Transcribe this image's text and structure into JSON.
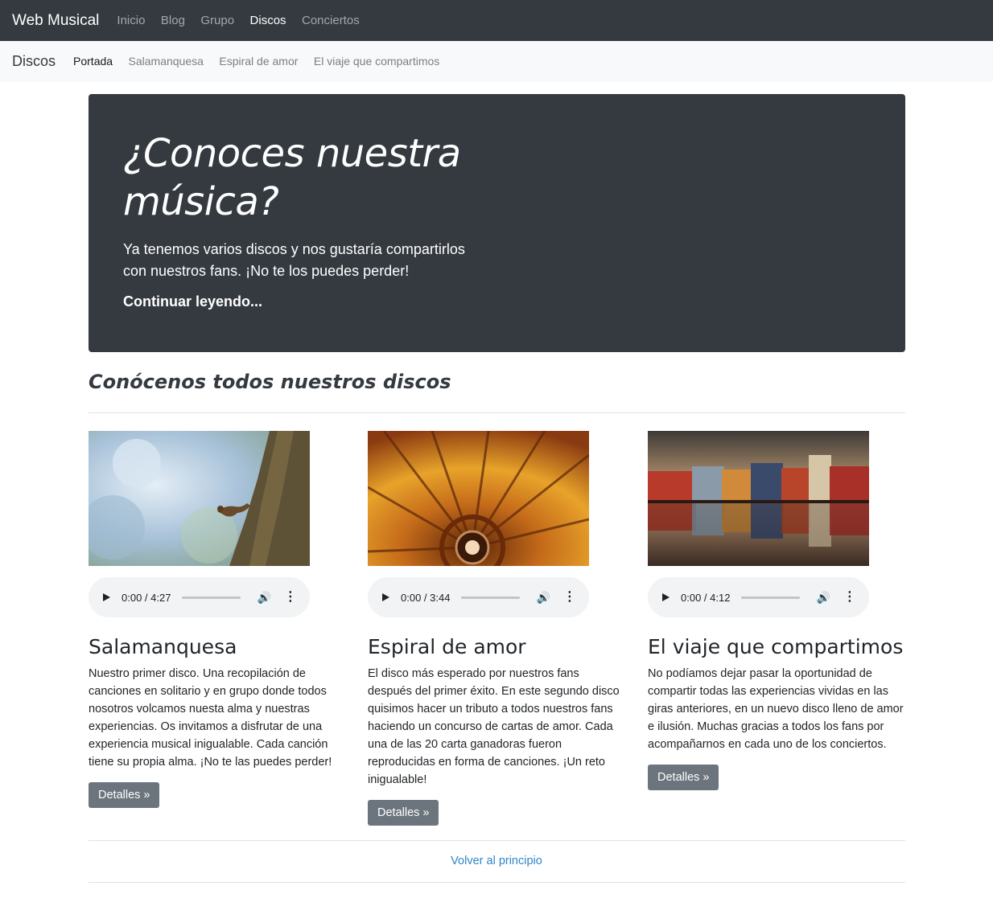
{
  "navbar": {
    "brand": "Web Musical",
    "items": [
      {
        "label": "Inicio"
      },
      {
        "label": "Blog"
      },
      {
        "label": "Grupo"
      },
      {
        "label": "Discos"
      },
      {
        "label": "Conciertos"
      }
    ]
  },
  "subnav": {
    "title": "Discos",
    "items": [
      {
        "label": "Portada"
      },
      {
        "label": "Salamanquesa"
      },
      {
        "label": "Espiral de amor"
      },
      {
        "label": "El viaje que compartimos"
      }
    ]
  },
  "hero": {
    "title": "¿Conoces nuestra música?",
    "lead": "Ya tenemos varios discos y nos gustaría compartirlos con nuestros fans. ¡No te los puedes perder!",
    "more_link": "Continuar leyendo..."
  },
  "section_title": "Conócenos todos nuestros discos",
  "albums": [
    {
      "title": "Salamanquesa",
      "time": "0:00 / 4:27",
      "description": "Nuestro primer disco. Una recopilación de canciones en solitario y en grupo donde todos nosotros volcamos nuesta alma y nuestras experiencias. Os invitamos a disfrutar de una experiencia musical inigualable. Cada canción tiene su propia alma. ¡No te las puedes perder!",
      "button": "Detalles »"
    },
    {
      "title": "Espiral de amor",
      "time": "0:00 / 3:44",
      "description": "El disco más esperado por nuestros fans después del primer éxito. En este segundo disco quisimos hacer un tributo a todos nuestros fans haciendo un concurso de cartas de amor. Cada una de las 20 carta ganadoras fueron reproducidas en forma de canciones. ¡Un reto inigualable!",
      "button": "Detalles »"
    },
    {
      "title": "El viaje que compartimos",
      "time": "0:00 / 4:12",
      "description": "No podíamos dejar pasar la oportunidad de compartir todas las experiencias vividas en las giras anteriores, en un nuevo disco lleno de amor e ilusión. Muchas gracias a todos los fans por acompañarnos en cada uno de los conciertos.",
      "button": "Detalles »"
    }
  ],
  "footer": {
    "back_link": "Volver al principio"
  }
}
